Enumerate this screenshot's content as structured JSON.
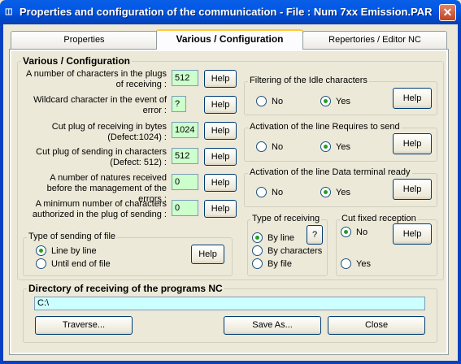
{
  "window": {
    "title": "Properties and configuration of the communication - File : Num 7xx Emission.PAR",
    "icon": "app-icon",
    "close": "close-icon"
  },
  "tabs": [
    {
      "label": "Properties",
      "active": false
    },
    {
      "label": "Various / Configuration",
      "active": true
    },
    {
      "label": "Repertories / Editor NC",
      "active": false
    }
  ],
  "various": {
    "title": "Various / Configuration",
    "rows": [
      {
        "label": "A number of characters in the plugs of receiving :",
        "value": "512",
        "help": "Help"
      },
      {
        "label": "Wildcard character in the event of error :",
        "value": "?",
        "help": "Help"
      },
      {
        "label": "Cut plug of receiving in bytes (Defect:1024) :",
        "value": "1024",
        "help": "Help"
      },
      {
        "label": "Cut plug of sending in characters (Defect: 512) :",
        "value": "512",
        "help": "Help"
      },
      {
        "label": "A number of natures received before the management of the errors :",
        "value": "0",
        "help": "Help"
      },
      {
        "label": "A minimum number of characters authorized in the plug of sending :",
        "value": "0",
        "help": "Help"
      }
    ]
  },
  "sending_type": {
    "title": "Type of sending of file",
    "options": [
      "Line by line",
      "Until end of file"
    ],
    "selected": 0,
    "help": "Help"
  },
  "idle_filter": {
    "title": "Filtering of the Idle characters",
    "no": "No",
    "yes": "Yes",
    "selected": "yes",
    "help": "Help"
  },
  "requires_send": {
    "title": "Activation of the line Requires to send",
    "no": "No",
    "yes": "Yes",
    "selected": "yes",
    "help": "Help"
  },
  "terminal_ready": {
    "title": "Activation of the line Data terminal ready",
    "no": "No",
    "yes": "Yes",
    "selected": "yes",
    "help": "Help"
  },
  "receiving_type": {
    "title": "Type of receiving",
    "options": [
      "By line",
      "By characters",
      "By file"
    ],
    "selected": 0,
    "help": "?"
  },
  "cut_fixed": {
    "title": "Cut fixed reception",
    "no": "No",
    "yes": "Yes",
    "selected": "no",
    "help": "Help"
  },
  "directory": {
    "title": "Directory of receiving of the programs NC",
    "value": "C:\\"
  },
  "buttons": {
    "traverse": "Traverse...",
    "save_as": "Save As...",
    "close": "Close"
  },
  "colors": {
    "titlebar": "#0058e6",
    "field_green": "#ccffcc",
    "field_cyan": "#ccffff",
    "dialog_bg": "#ece9d8"
  }
}
